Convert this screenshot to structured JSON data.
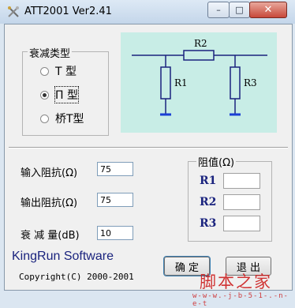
{
  "window": {
    "title": "ATT2001 Ver2.41",
    "min_symbol": "–",
    "max_symbol": "□",
    "close_symbol": "✕"
  },
  "attenuation_type": {
    "legend": "衰减类型",
    "options": [
      {
        "label": "T 型",
        "checked": false
      },
      {
        "label": "Π 型",
        "checked": true
      },
      {
        "label": "桥T型",
        "checked": false
      }
    ]
  },
  "diagram": {
    "resistor_labels": [
      "R2",
      "R1",
      "R3"
    ],
    "colors": {
      "background": "#c8ede6",
      "wire": "#1a237e",
      "ground": "#1a3fd6"
    }
  },
  "inputs": {
    "input_impedance": {
      "label": "输入阻抗(Ω)",
      "value": "75"
    },
    "output_impedance": {
      "label": "输出阻抗(Ω)",
      "value": "75"
    },
    "attenuation": {
      "label": "衰 减 量(dB)",
      "value": "10"
    }
  },
  "resistance": {
    "legend": "阻值(Ω)",
    "rows": [
      {
        "label": "R1",
        "value": ""
      },
      {
        "label": "R2",
        "value": ""
      },
      {
        "label": "R3",
        "value": ""
      }
    ]
  },
  "footer": {
    "brand": "KingRun Software",
    "copyright": "Copyright(C) 2000-2001",
    "ok_label": "确 定",
    "exit_label": "退 出"
  },
  "watermark": {
    "main": "脚本之家",
    "sub": "w-w-w.-j-b-5-1-.-n-e-t"
  }
}
